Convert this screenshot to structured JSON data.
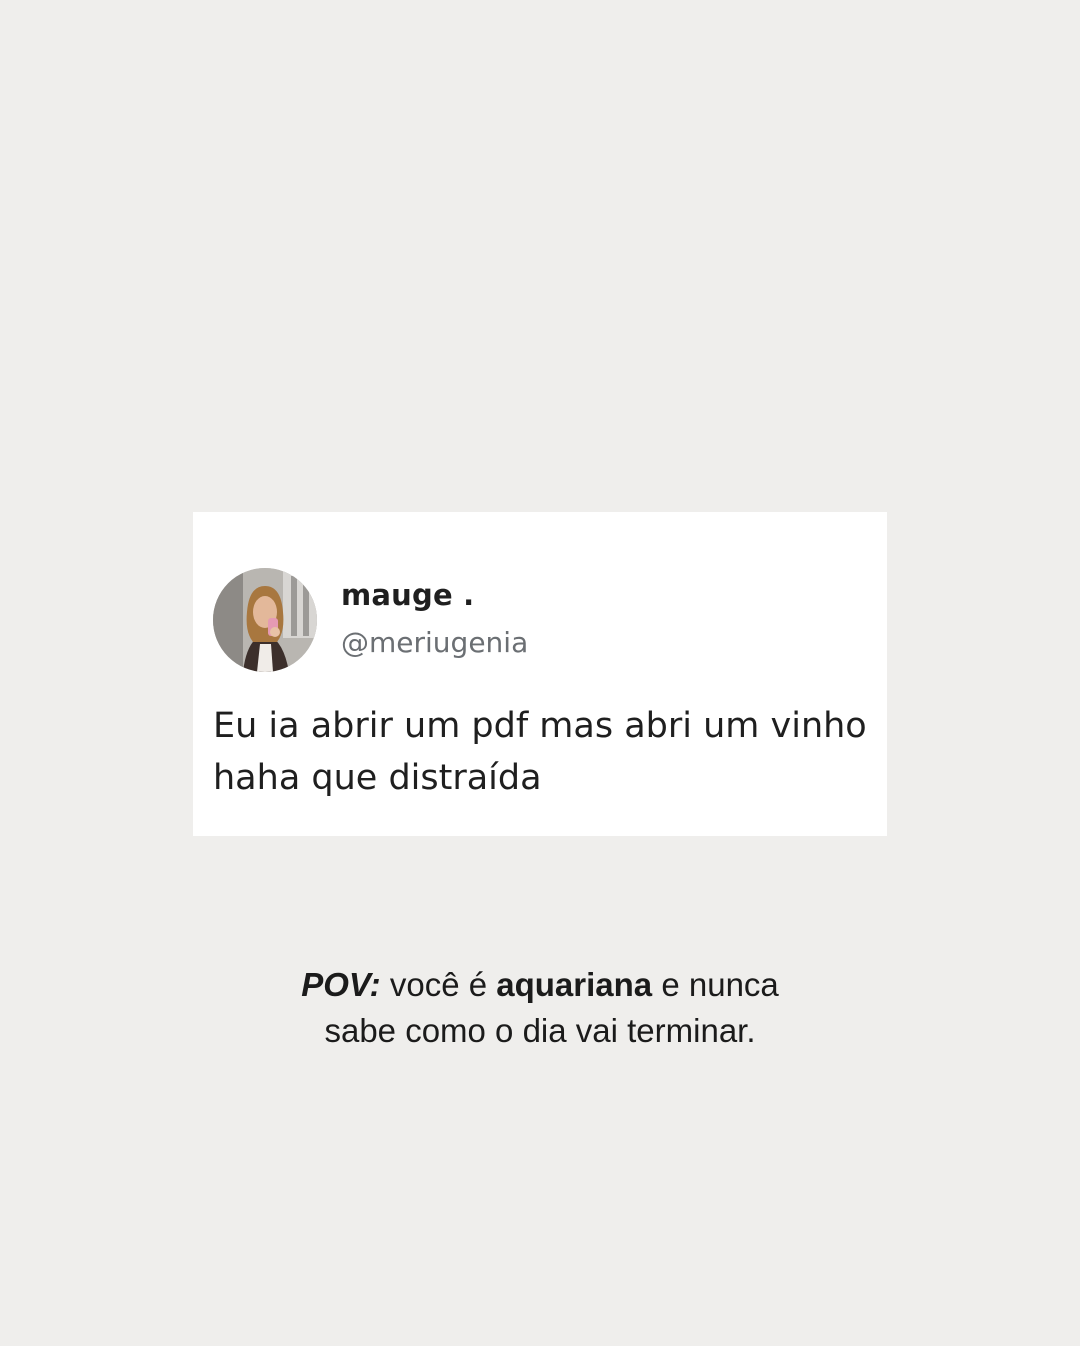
{
  "tweet": {
    "display_name": "mauge .",
    "handle": "@meriugenia",
    "text_lines": [
      "Eu ia abrir um pdf mas abri um vinho",
      "haha que distraída"
    ],
    "avatar": "profile-photo"
  },
  "caption": {
    "pov_label": "POV:",
    "line1_part1": " você é ",
    "line1_bold": "aquariana",
    "line1_part2": " e nunca",
    "line2": "sabe como o dia vai terminar."
  },
  "colors": {
    "background": "#efeeec",
    "card": "#ffffff",
    "text": "#1f1f1f",
    "handle": "#6b6f73"
  }
}
